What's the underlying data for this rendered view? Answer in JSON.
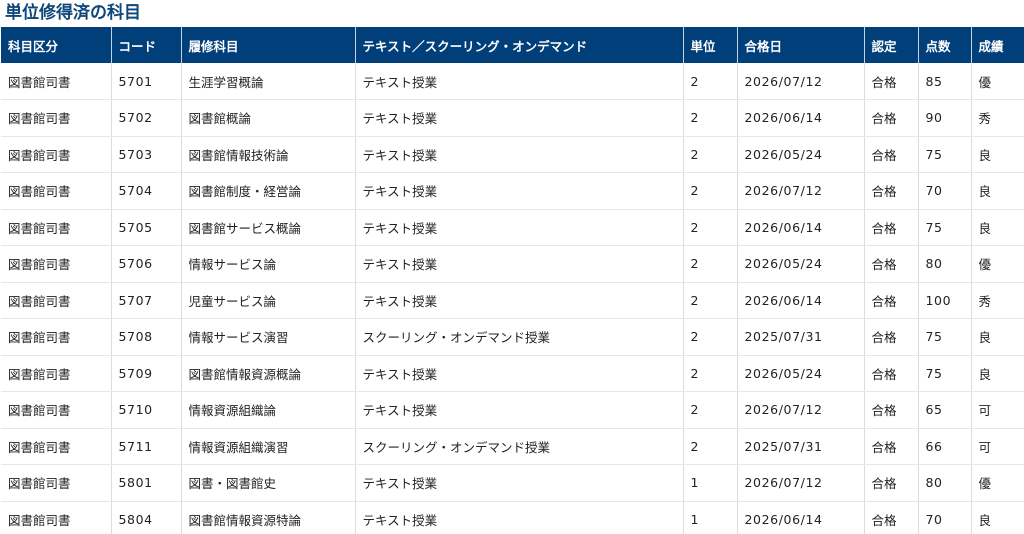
{
  "page": {
    "title": "単位修得済の科目"
  },
  "table": {
    "headers": [
      "科目区分",
      "コード",
      "履修科目",
      "テキスト／スクーリング・オンデマンド",
      "単位",
      "合格日",
      "認定",
      "点数",
      "成績"
    ],
    "rows": [
      [
        "図書館司書",
        "5701",
        "生涯学習概論",
        "テキスト授業",
        "2",
        "2026/07/12",
        "合格",
        "85",
        "優"
      ],
      [
        "図書館司書",
        "5702",
        "図書館概論",
        "テキスト授業",
        "2",
        "2026/06/14",
        "合格",
        "90",
        "秀"
      ],
      [
        "図書館司書",
        "5703",
        "図書館情報技術論",
        "テキスト授業",
        "2",
        "2026/05/24",
        "合格",
        "75",
        "良"
      ],
      [
        "図書館司書",
        "5704",
        "図書館制度・経営論",
        "テキスト授業",
        "2",
        "2026/07/12",
        "合格",
        "70",
        "良"
      ],
      [
        "図書館司書",
        "5705",
        "図書館サービス概論",
        "テキスト授業",
        "2",
        "2026/06/14",
        "合格",
        "75",
        "良"
      ],
      [
        "図書館司書",
        "5706",
        "情報サービス論",
        "テキスト授業",
        "2",
        "2026/05/24",
        "合格",
        "80",
        "優"
      ],
      [
        "図書館司書",
        "5707",
        "児童サービス論",
        "テキスト授業",
        "2",
        "2026/06/14",
        "合格",
        "100",
        "秀"
      ],
      [
        "図書館司書",
        "5708",
        "情報サービス演習",
        "スクーリング・オンデマンド授業",
        "2",
        "2025/07/31",
        "合格",
        "75",
        "良"
      ],
      [
        "図書館司書",
        "5709",
        "図書館情報資源概論",
        "テキスト授業",
        "2",
        "2026/05/24",
        "合格",
        "75",
        "良"
      ],
      [
        "図書館司書",
        "5710",
        "情報資源組織論",
        "テキスト授業",
        "2",
        "2026/07/12",
        "合格",
        "65",
        "可"
      ],
      [
        "図書館司書",
        "5711",
        "情報資源組織演習",
        "スクーリング・オンデマンド授業",
        "2",
        "2025/07/31",
        "合格",
        "66",
        "可"
      ],
      [
        "図書館司書",
        "5801",
        "図書・図書館史",
        "テキスト授業",
        "1",
        "2026/07/12",
        "合格",
        "80",
        "優"
      ],
      [
        "図書館司書",
        "5804",
        "図書館情報資源特論",
        "テキスト授業",
        "1",
        "2026/06/14",
        "合格",
        "70",
        "良"
      ]
    ]
  },
  "colors": {
    "header_bg": "#003f7a",
    "title": "#0d4678"
  }
}
